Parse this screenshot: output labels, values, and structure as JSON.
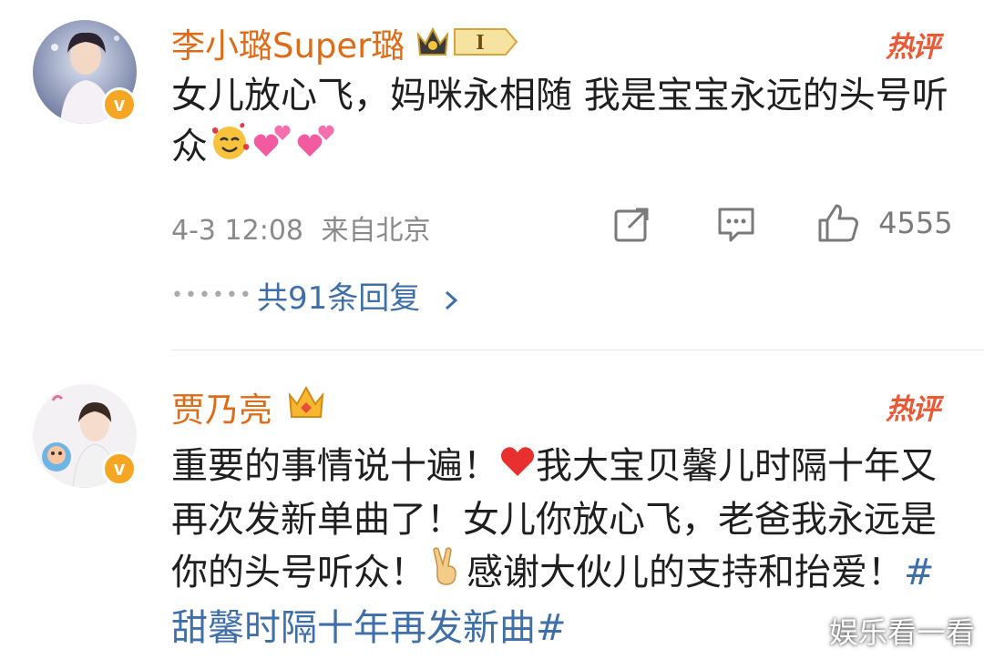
{
  "comments": [
    {
      "username": "李小璐Super璐",
      "level": "I",
      "hot_label": "热评",
      "text": "女儿放心飞，妈咪永相随 我是宝宝永远的头号听众",
      "emojis": [
        "smiling-face-with-hearts",
        "two-hearts",
        "two-hearts"
      ],
      "date": "4-3 12:08",
      "location": "来自北京",
      "like_count": "4555",
      "reply_link": "共91条回复",
      "badge": "v"
    },
    {
      "username": "贾乃亮",
      "hot_label": "热评",
      "text_part1": "重要的事情说十遍！",
      "emoji_heart": "red-heart",
      "text_part2": "我大宝贝馨儿时隔十年又再次发新单曲了！女儿你放心飞，老爸我永远是你的头号听众！",
      "emoji_victory": "victory-hand",
      "text_part3": "感谢大伙儿的支持和抬爱！",
      "hashtag": "#甜馨时隔十年再发新曲#",
      "badge": "v"
    }
  ],
  "watermark": "娱乐看一看",
  "colors": {
    "username": "#e06b17",
    "hot": "#ea5a36",
    "link": "#3f6fa8",
    "meta": "#8a8a8a"
  }
}
